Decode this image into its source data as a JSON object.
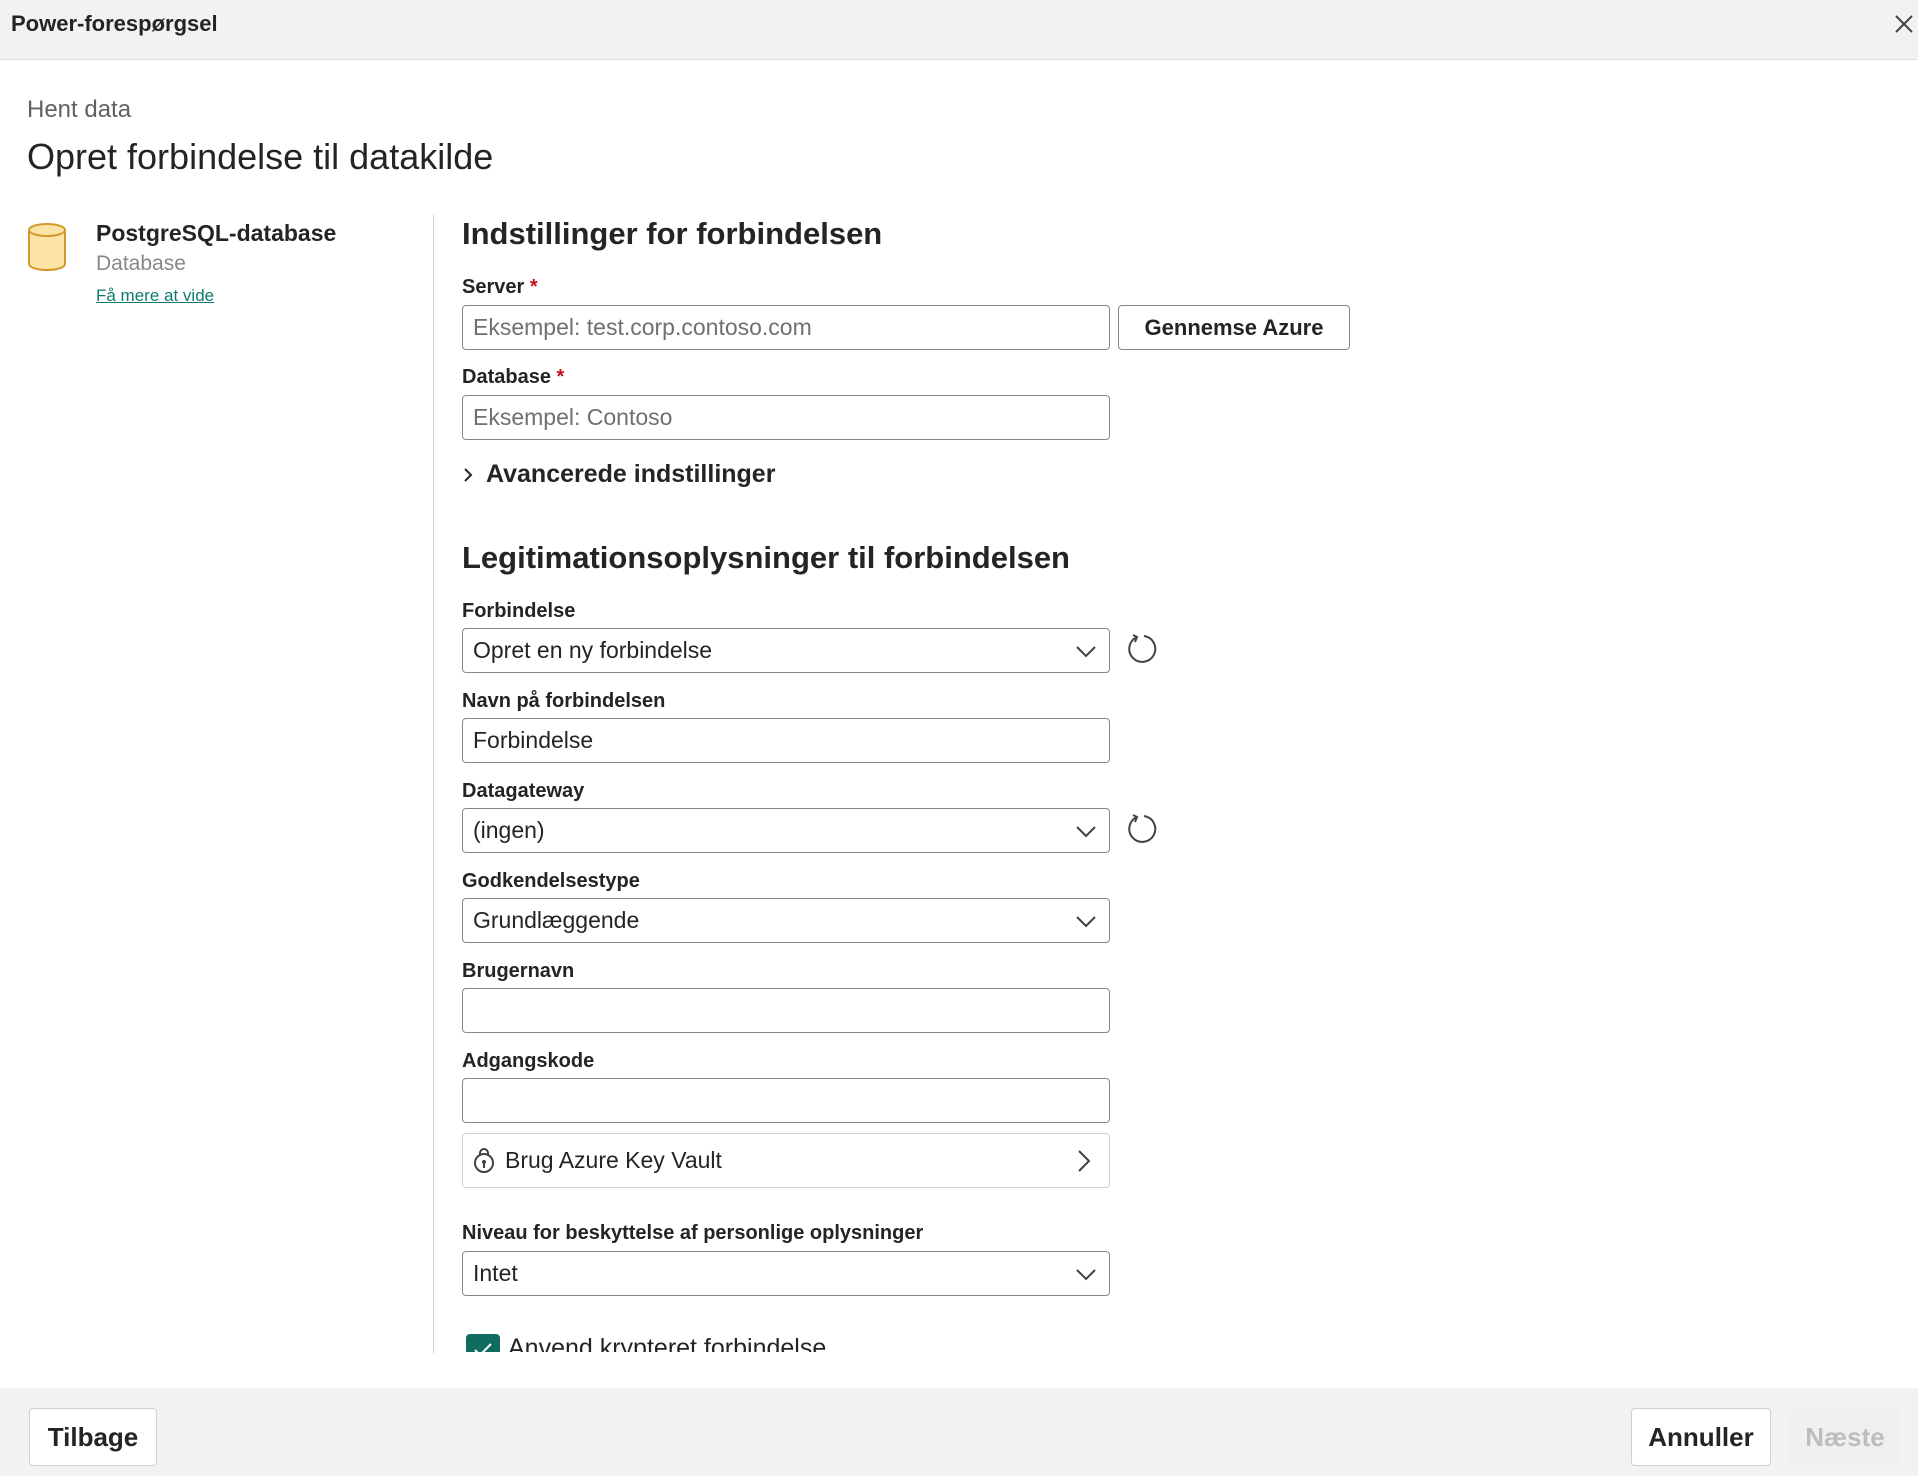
{
  "window": {
    "title": "Power-forespørgsel"
  },
  "header": {
    "breadcrumb": "Hent data",
    "title": "Opret forbindelse til datakilde"
  },
  "connector": {
    "name": "PostgreSQL-database",
    "type": "Database",
    "learn_more": "Få mere at vide",
    "icon": "database-cylinder-icon"
  },
  "settings": {
    "title": "Indstillinger for forbindelsen",
    "server_label": "Server",
    "required_mark": "*",
    "server_placeholder": "Eksempel: test.corp.contoso.com",
    "browse_azure": "Gennemse Azure",
    "database_label": "Database",
    "database_placeholder": "Eksempel: Contoso",
    "advanced": "Avancerede indstillinger"
  },
  "credentials": {
    "title": "Legitimationsoplysninger til forbindelsen",
    "connection_label": "Forbindelse",
    "connection_value": "Opret en ny forbindelse",
    "connection_name_label": "Navn på forbindelsen",
    "connection_name_value": "Forbindelse",
    "gateway_label": "Datagateway",
    "gateway_value": "(ingen)",
    "auth_label": "Godkendelsestype",
    "auth_value": "Grundlæggende",
    "username_label": "Brugernavn",
    "username_value": "",
    "password_label": "Adgangskode",
    "password_value": "",
    "keyvault_label": "Brug Azure Key Vault",
    "privacy_label": "Niveau for beskyttelse af personlige oplysninger",
    "privacy_value": "Intet",
    "encrypted_label": "Anvend krypteret forbindelse",
    "encrypted_checked": true
  },
  "footer": {
    "back": "Tilbage",
    "cancel": "Annuller",
    "next": "Næste"
  },
  "colors": {
    "accent": "#0f6b5f",
    "link": "#0f7b6c",
    "required": "#c50f1f",
    "db_icon_fill": "#fce4a6",
    "db_icon_stroke": "#d39b2a"
  }
}
